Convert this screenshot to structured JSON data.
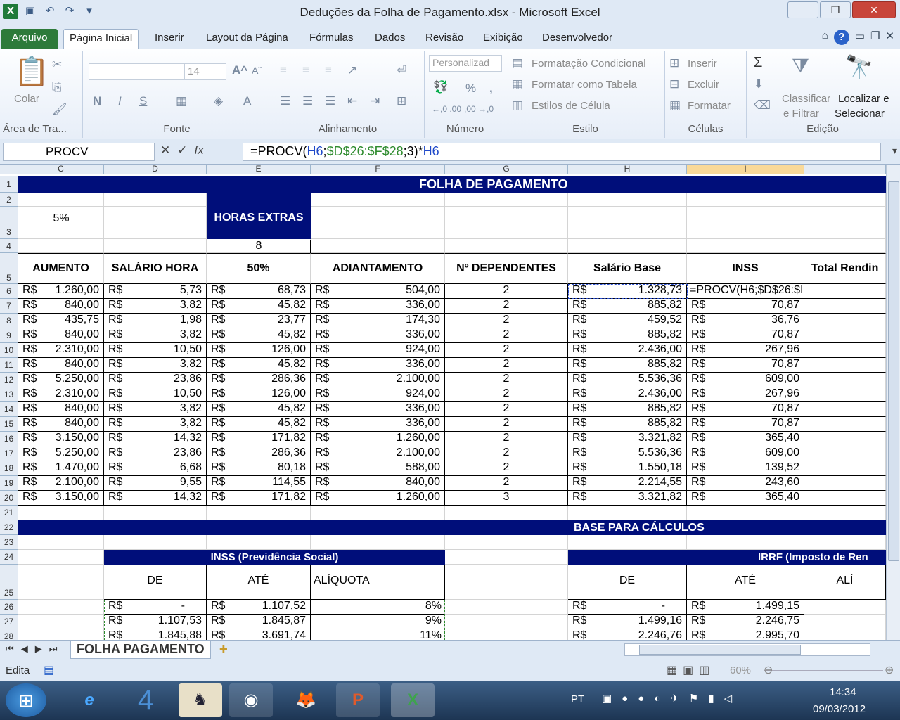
{
  "window": {
    "title": "Deduções da Folha de Pagamento.xlsx - Microsoft Excel"
  },
  "ribbon_tabs": [
    "Arquivo",
    "Página Inicial",
    "Inserir",
    "Layout da Página",
    "Fórmulas",
    "Dados",
    "Revisão",
    "Exibição",
    "Desenvolvedor"
  ],
  "ribbon": {
    "clipboard": {
      "paste": "Colar",
      "label": "Área de Tra..."
    },
    "font": {
      "size": "14",
      "bold": "N",
      "italic": "I",
      "underline": "S",
      "label": "Fonte"
    },
    "alignment": {
      "label": "Alinhamento"
    },
    "number": {
      "format": "Personalizad",
      "percent": "%",
      "comma": ",",
      "inc": "←,0 .00",
      "dec": ",00 →,0",
      "label": "Número"
    },
    "styles": {
      "conditional": "Formatação Condicional",
      "table": "Formatar como Tabela",
      "cell": "Estilos de Célula",
      "label": "Estilo"
    },
    "cells": {
      "insert": "Inserir",
      "delete": "Excluir",
      "format": "Formatar",
      "label": "Células"
    },
    "editing": {
      "sort1": "Classificar",
      "sort2": "e Filtrar",
      "find1": "Localizar e",
      "find2": "Selecionar",
      "label": "Edição"
    }
  },
  "formula_bar": {
    "name_box": "PROCV",
    "eq": "=PROCV(",
    "a1": "H6",
    "s1": ";",
    "a2": "$D$26:$F$28",
    "s2": ";3)*",
    "a3": "H6"
  },
  "columns": [
    {
      "letter": "C"
    },
    {
      "letter": "D"
    },
    {
      "letter": "E"
    },
    {
      "letter": "F"
    },
    {
      "letter": "G"
    },
    {
      "letter": "H"
    },
    {
      "letter": "I"
    }
  ],
  "rows_numbers": [
    "1",
    "2",
    "3",
    "4",
    "5",
    "6",
    "7",
    "8",
    "9",
    "10",
    "11",
    "12",
    "13",
    "14",
    "15",
    "16",
    "17",
    "18",
    "19",
    "20",
    "21",
    "22",
    "23",
    "24",
    "25",
    "26",
    "27",
    "28"
  ],
  "sheet": {
    "title": "FOLHA DE PAGAMENTO",
    "pct": "5%",
    "horas_extras": "HORAS EXTRAS",
    "horas_val": "8",
    "headers": [
      "AUMENTO",
      "SALÁRIO HORA",
      "50%",
      "ADIANTAMENTO",
      "Nº DEPENDENTES",
      "Salário Base",
      "INSS",
      "Total Rendin"
    ],
    "currency": "R$",
    "editing_text": "=PROCV(H6;$D$26:$I",
    "data": [
      [
        "1.260,00",
        "5,73",
        "68,73",
        "504,00",
        "2",
        "1.328,73",
        ""
      ],
      [
        "840,00",
        "3,82",
        "45,82",
        "336,00",
        "2",
        "885,82",
        "70,87"
      ],
      [
        "435,75",
        "1,98",
        "23,77",
        "174,30",
        "2",
        "459,52",
        "36,76"
      ],
      [
        "840,00",
        "3,82",
        "45,82",
        "336,00",
        "2",
        "885,82",
        "70,87"
      ],
      [
        "2.310,00",
        "10,50",
        "126,00",
        "924,00",
        "2",
        "2.436,00",
        "267,96"
      ],
      [
        "840,00",
        "3,82",
        "45,82",
        "336,00",
        "2",
        "885,82",
        "70,87"
      ],
      [
        "5.250,00",
        "23,86",
        "286,36",
        "2.100,00",
        "2",
        "5.536,36",
        "609,00"
      ],
      [
        "2.310,00",
        "10,50",
        "126,00",
        "924,00",
        "2",
        "2.436,00",
        "267,96"
      ],
      [
        "840,00",
        "3,82",
        "45,82",
        "336,00",
        "2",
        "885,82",
        "70,87"
      ],
      [
        "840,00",
        "3,82",
        "45,82",
        "336,00",
        "2",
        "885,82",
        "70,87"
      ],
      [
        "3.150,00",
        "14,32",
        "171,82",
        "1.260,00",
        "2",
        "3.321,82",
        "365,40"
      ],
      [
        "5.250,00",
        "23,86",
        "286,36",
        "2.100,00",
        "2",
        "5.536,36",
        "609,00"
      ],
      [
        "1.470,00",
        "6,68",
        "80,18",
        "588,00",
        "2",
        "1.550,18",
        "139,52"
      ],
      [
        "2.100,00",
        "9,55",
        "114,55",
        "840,00",
        "2",
        "2.214,55",
        "243,60"
      ],
      [
        "3.150,00",
        "14,32",
        "171,82",
        "1.260,00",
        "3",
        "3.321,82",
        "365,40"
      ]
    ],
    "base_title": "BASE PARA CÁLCULOS",
    "inss_title": "INSS (Previdência Social)",
    "irrf_title": "IRRF (Imposto de Ren",
    "inss_headers": [
      "DE",
      "ATÉ",
      "ALÍQUOTA"
    ],
    "irrf_headers": [
      "DE",
      "ATÉ",
      "ALÍ"
    ],
    "inss_rows": [
      [
        "-",
        "1.107,52",
        "8%"
      ],
      [
        "1.107,53",
        "1.845,87",
        "9%"
      ],
      [
        "1.845,88",
        "3.691,74",
        "11%"
      ]
    ],
    "irrf_rows": [
      [
        "-",
        "1.499,15"
      ],
      [
        "1.499,16",
        "2.246,75"
      ],
      [
        "2.246,76",
        "2.995,70"
      ]
    ]
  },
  "sheet_tab": "FOLHA PAGAMENTO",
  "status": {
    "mode": "Edita",
    "zoom": "60%"
  },
  "taskbar": {
    "lang": "PT",
    "time": "14:34",
    "date": "09/03/2012"
  }
}
